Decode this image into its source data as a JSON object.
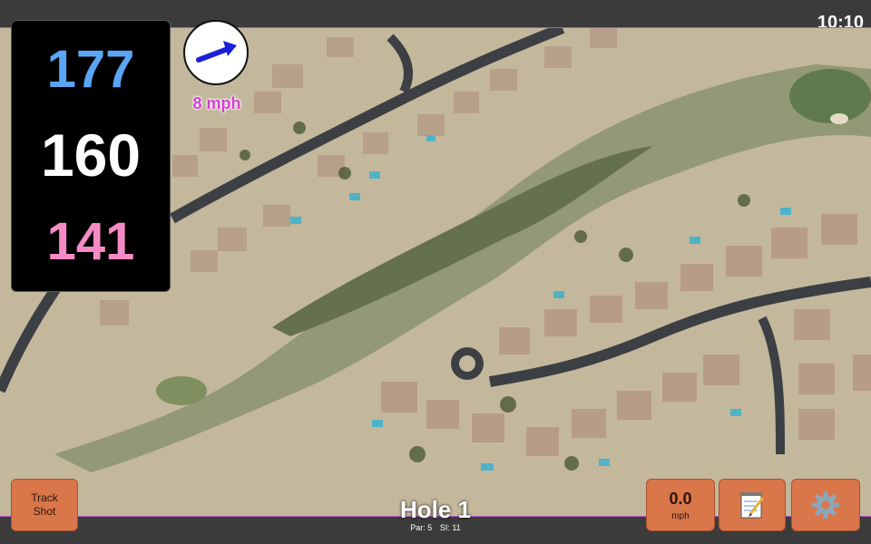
{
  "status_bar": {
    "time": "10:10"
  },
  "yardage": {
    "back": "177",
    "center": "160",
    "front": "141"
  },
  "wind": {
    "speed_label": "8 mph",
    "direction_icon": "arrow-right-up-icon",
    "color": "#d23fd1"
  },
  "hole": {
    "title": "Hole 1",
    "par_label": "Par: 5",
    "si_label": "SI: 11"
  },
  "buttons": {
    "track_shot": {
      "line1": "Track",
      "line2": "Shot"
    },
    "speed": {
      "value": "0.0",
      "unit": "mph"
    },
    "notes_icon": "notepad-icon",
    "settings_icon": "gear-icon"
  },
  "colors": {
    "button_bg": "#d9764a",
    "back_yardage": "#5aa6f5",
    "front_yardage": "#f58bc4",
    "frame": "#b455c9"
  }
}
